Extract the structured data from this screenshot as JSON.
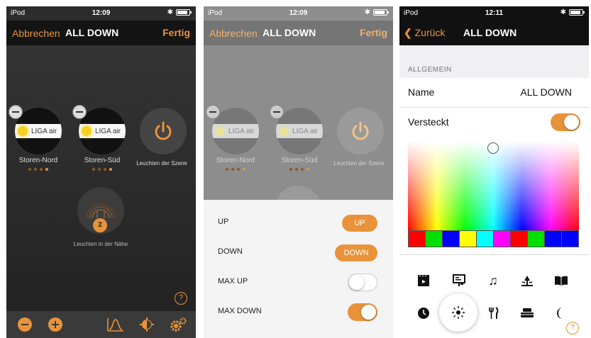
{
  "status": {
    "carrier": "iPod",
    "time_1": "12:09",
    "time_2": "12:09",
    "time_3": "12:11"
  },
  "screen1": {
    "nav": {
      "cancel": "Abbrechen",
      "title": "ALL DOWN",
      "done": "Fertig"
    },
    "tiles": [
      {
        "device_label": "LIGA air",
        "name": "Storen-Nord"
      },
      {
        "device_label": "LIGA air",
        "name": "Storen-Süd"
      },
      {
        "name": "Leuchten der Szene"
      }
    ],
    "nearby": {
      "label": "Leuchten in der Nähe",
      "count": "2"
    },
    "help": "?",
    "toolbar": [
      "minus-icon",
      "plus-icon",
      "chart-icon",
      "light-icon",
      "gear-icon"
    ]
  },
  "screen2": {
    "nav": {
      "cancel": "Abbrechen",
      "title": "ALL DOWN",
      "done": "Fertig"
    },
    "tiles": [
      {
        "device_label": "LIGA air",
        "name": "Storen-Nord"
      },
      {
        "device_label": "LIGA air",
        "name": "Storen-Süd"
      },
      {
        "name": "Leuchten der Szene"
      }
    ],
    "rows": [
      {
        "label": "UP",
        "button": "UP"
      },
      {
        "label": "DOWN",
        "button": "DOWN"
      },
      {
        "label": "MAX UP",
        "toggle": false
      },
      {
        "label": "MAX DOWN",
        "toggle": true
      }
    ]
  },
  "screen3": {
    "nav": {
      "back": "Zurück",
      "title": "ALL DOWN"
    },
    "section": "ALLGEMEIN",
    "name_label": "Name",
    "name_value": "ALL DOWN",
    "hidden_label": "Versteckt",
    "hidden_on": true,
    "swatch_colors": [
      "#ff0000",
      "#00e000",
      "#0000ff",
      "#ffff00",
      "#00ffff",
      "#ff00ff",
      "#ff0000",
      "#00e000",
      "#0000ff",
      "#0000ff"
    ],
    "icons_row1": [
      "movie-icon",
      "presentation-icon",
      "music-icon",
      "lamp-icon",
      "book-icon"
    ],
    "icons_row2": [
      "clock-icon",
      "sun-icon",
      "dining-icon",
      "bed-icon",
      "moon-icon"
    ],
    "selected_icon": "sun-icon",
    "help": "?"
  },
  "colors": {
    "accent": "#e8933a"
  }
}
